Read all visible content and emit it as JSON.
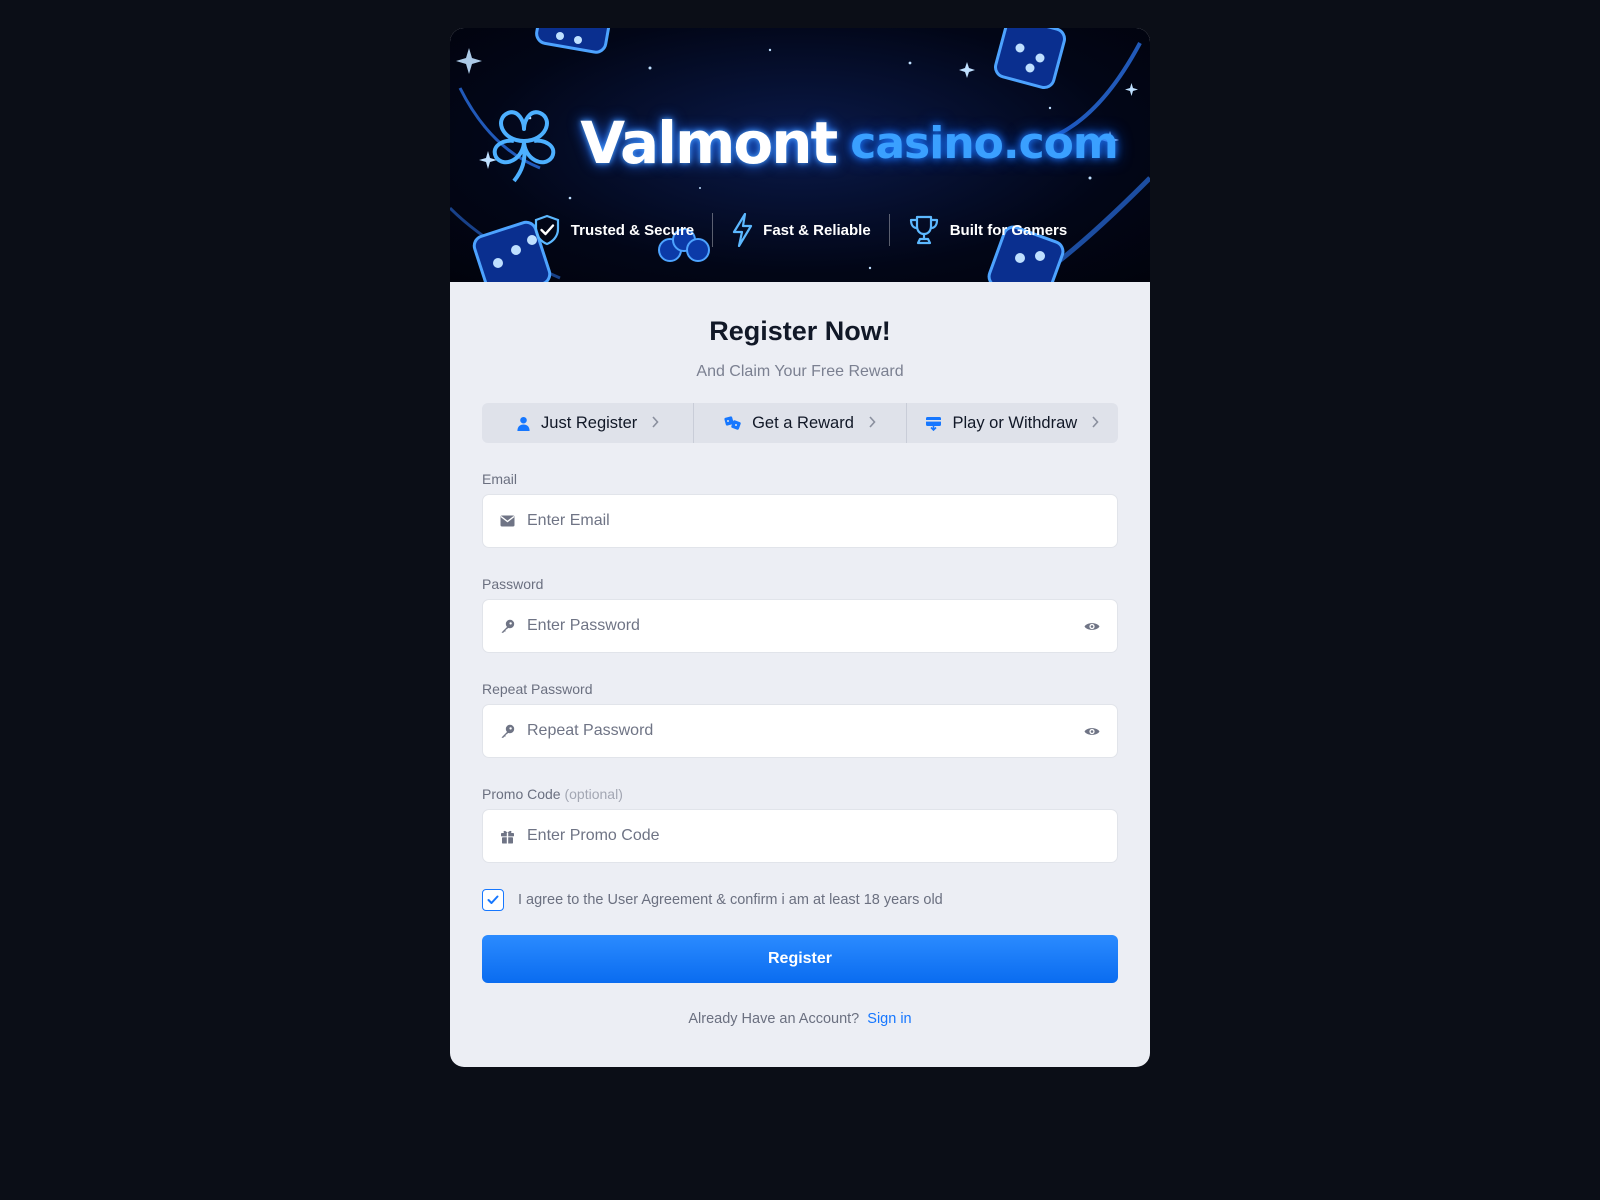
{
  "banner": {
    "brand_main": "Valmont",
    "brand_accent": "casino.com",
    "features": [
      {
        "icon": "shield-check-icon",
        "label": "Trusted & Secure"
      },
      {
        "icon": "lightning-icon",
        "label": "Fast & Reliable"
      },
      {
        "icon": "trophy-icon",
        "label": "Built for Gamers"
      }
    ]
  },
  "form": {
    "title": "Register Now!",
    "subtitle": "And Claim Your Free Reward",
    "steps": [
      {
        "icon": "user-icon",
        "label": "Just Register"
      },
      {
        "icon": "reward-icon",
        "label": "Get a Reward"
      },
      {
        "icon": "wallet-icon",
        "label": "Play or Withdraw"
      }
    ],
    "email": {
      "label": "Email",
      "placeholder": "Enter Email",
      "value": ""
    },
    "password": {
      "label": "Password",
      "placeholder": "Enter Password",
      "value": ""
    },
    "repeat_password": {
      "label": "Repeat Password",
      "placeholder": "Repeat Password",
      "value": ""
    },
    "promo": {
      "label": "Promo Code",
      "optional": "(optional)",
      "placeholder": "Enter Promo Code",
      "value": ""
    },
    "agree_text": "I agree to the User Agreement & confirm i am at least 18 years old",
    "agree_checked": true,
    "register_label": "Register",
    "signin_prompt": "Already Have an Account?",
    "signin_link": "Sign in"
  },
  "colors": {
    "accent": "#1677ff",
    "page_bg": "#0b0e17",
    "card_bg": "#eceef4"
  }
}
